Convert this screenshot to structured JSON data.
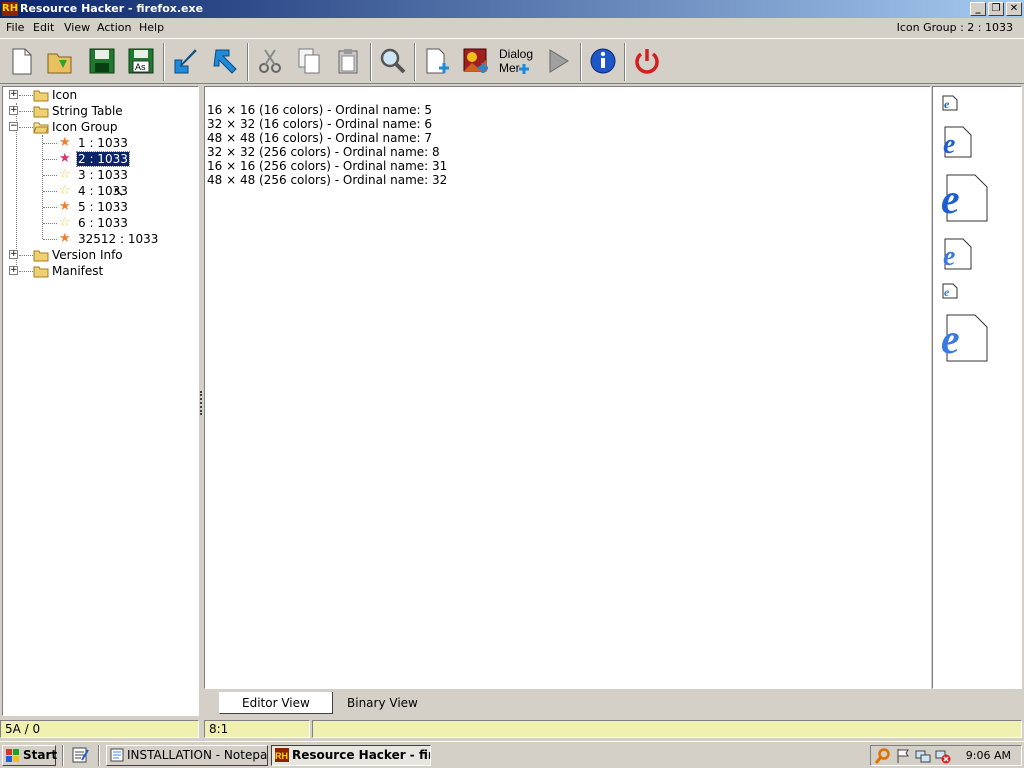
{
  "window": {
    "app_icon_text": "RH",
    "title": "Resource Hacker - firefox.exe"
  },
  "menu": {
    "items": [
      "File",
      "Edit",
      "View",
      "Action",
      "Help"
    ],
    "status_right": "Icon Group : 2 : 1033"
  },
  "toolbar": {
    "buttons": [
      "new-file-icon",
      "open-folder-icon",
      "save-icon",
      "save-as-icon",
      "import-icon",
      "export-icon",
      "cut-icon",
      "copy-icon",
      "paste-icon",
      "search-icon",
      "add-resource-icon",
      "add-image-icon",
      "dialog-merger-icon",
      "run-icon",
      "info-icon",
      "power-icon"
    ],
    "save_as_label": "As",
    "dialog_label_1": "Dialog",
    "dialog_label_2": "Mer"
  },
  "tree": {
    "nodes": [
      {
        "label": "Icon",
        "expander": "+"
      },
      {
        "label": "String Table",
        "expander": "+"
      },
      {
        "label": "Icon Group",
        "expander": "−"
      },
      {
        "label": "1 : 1033"
      },
      {
        "label": "2 : 1033",
        "selected": true
      },
      {
        "label": "3 : 1033"
      },
      {
        "label": "4 : 1033"
      },
      {
        "label": "5 : 1033"
      },
      {
        "label": "6 : 1033"
      },
      {
        "label": "32512 : 1033"
      },
      {
        "label": "Version Info",
        "expander": "+"
      },
      {
        "label": "Manifest",
        "expander": "+"
      }
    ]
  },
  "editor": {
    "lines": [
      "16 × 16 (16 colors) - Ordinal name: 5",
      "32 × 32 (16 colors) - Ordinal name: 6",
      "48 × 48 (16 colors) - Ordinal name: 7",
      "32 × 32 (256 colors) - Ordinal name: 8",
      "16 × 16 (256 colors) - Ordinal name: 31",
      "48 × 48 (256 colors) - Ordinal name: 32"
    ]
  },
  "icon_preview": {
    "glyph": "e",
    "color": "#1e5fd0"
  },
  "tabs": {
    "editor": "Editor View",
    "binary": "Binary View"
  },
  "status": {
    "pane1": "5A / 0",
    "pane2": "8:1",
    "pane3": ""
  },
  "taskbar": {
    "start_label": "Start",
    "tasks": [
      "INSTALLATION - Notepad",
      "Resource Hacker - fir..."
    ],
    "clock": "9:06 AM"
  },
  "colors": {
    "title_start": "#0a246a",
    "title_end": "#a6caf0",
    "status_fill": "#f0f0b0",
    "star_orange": "#f08030",
    "star_pink": "#e03070",
    "star_yellow": "#f0e060"
  }
}
